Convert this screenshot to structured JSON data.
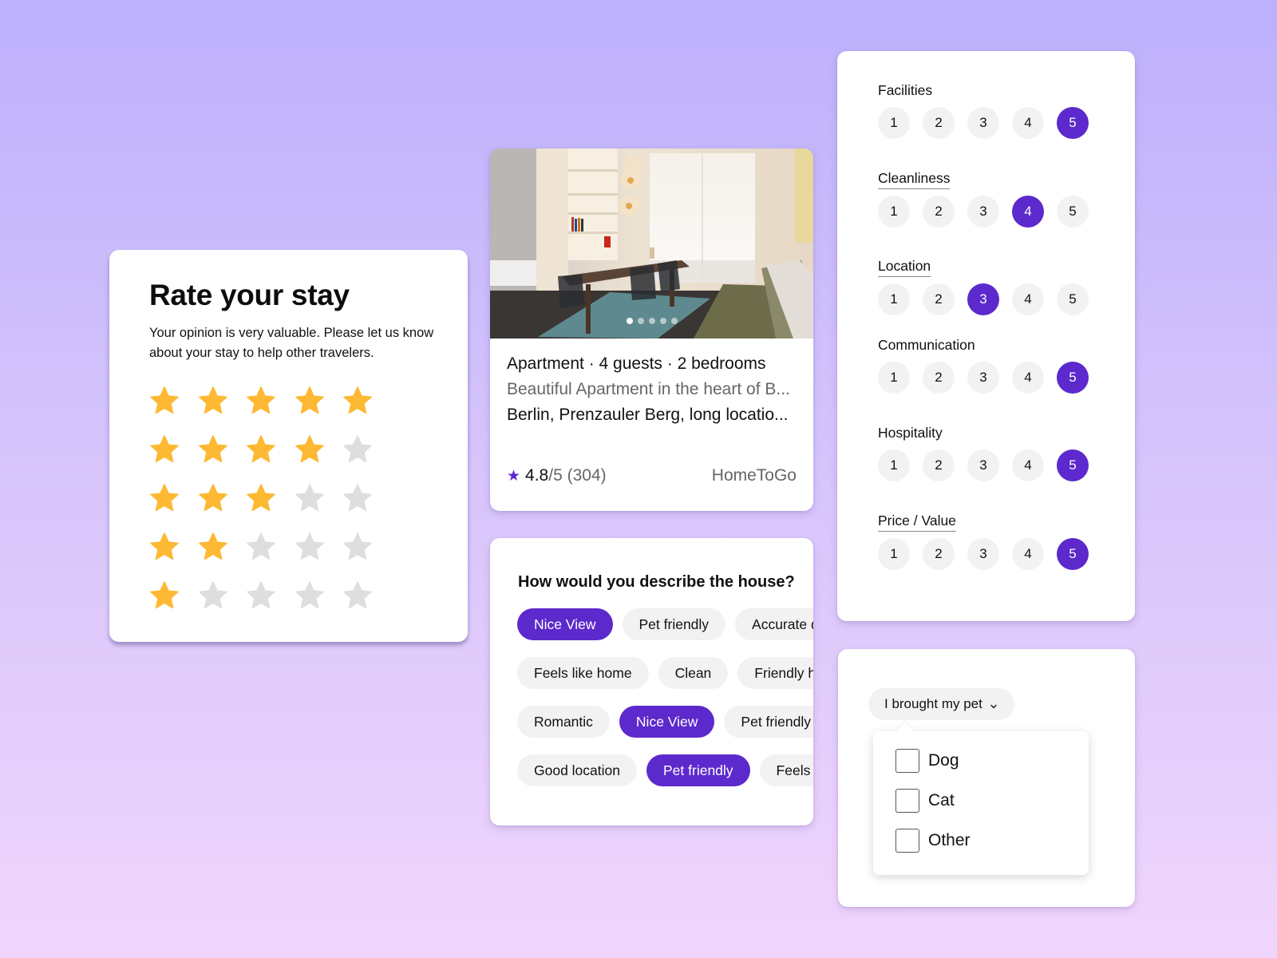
{
  "colors": {
    "accent": "#5c29cc",
    "star_filled": "#fdb933",
    "star_empty": "#dedede",
    "chip_bg": "#f2f2f2"
  },
  "rate_card": {
    "title": "Rate your stay",
    "subtitle": "Your opinion is very valuable. Please let us know about your stay to help other travelers.",
    "star_rows": [
      {
        "filled": 5,
        "total": 5
      },
      {
        "filled": 4,
        "total": 5
      },
      {
        "filled": 3,
        "total": 5
      },
      {
        "filled": 2,
        "total": 5
      },
      {
        "filled": 1,
        "total": 5
      }
    ]
  },
  "listing": {
    "photo_icon": "apartment-photo",
    "photo_count": 5,
    "photo_active_index": 0,
    "type_line": "Apartment · 4 guests · 2 bedrooms",
    "description": "Beautiful Apartment in the heart of B...",
    "location": "Berlin, Prenzauler Berg, long locatio...",
    "rating_icon": "star-icon",
    "rating_score": "4.8",
    "rating_rest": "/5 (304)",
    "provider": "HomeToGo"
  },
  "describe": {
    "question": "How would you describe the house?",
    "rows": [
      [
        {
          "label": "Nice View",
          "selected": true
        },
        {
          "label": "Pet friendly",
          "selected": false
        },
        {
          "label": "Accurate description",
          "selected": false
        }
      ],
      [
        {
          "label": "Feels like home",
          "selected": false
        },
        {
          "label": "Clean",
          "selected": false
        },
        {
          "label": "Friendly host",
          "selected": false
        }
      ],
      [
        {
          "label": "Romantic",
          "selected": false
        },
        {
          "label": "Nice View",
          "selected": true
        },
        {
          "label": "Pet friendly",
          "selected": false
        }
      ],
      [
        {
          "label": "Good location",
          "selected": false
        },
        {
          "label": "Pet friendly",
          "selected": true
        },
        {
          "label": "Feels like home",
          "selected": false
        }
      ]
    ]
  },
  "categories": {
    "scale": [
      "1",
      "2",
      "3",
      "4",
      "5"
    ],
    "items": [
      {
        "label": "Facilities",
        "value": 5,
        "underlined": false
      },
      {
        "label": "Cleanliness",
        "value": 4,
        "underlined": true
      },
      {
        "label": "Location",
        "value": 3,
        "underlined": true
      },
      {
        "label": "Communication",
        "value": 5,
        "underlined": false
      },
      {
        "label": "Hospitality",
        "value": 5,
        "underlined": false
      },
      {
        "label": "Price / Value",
        "value": 5,
        "underlined": true
      }
    ]
  },
  "pet": {
    "dropdown_label": "I brought my pet",
    "dropdown_icon": "chevron-down-icon",
    "options": [
      {
        "label": "Dog",
        "checked": false
      },
      {
        "label": "Cat",
        "checked": false
      },
      {
        "label": "Other",
        "checked": false
      }
    ]
  }
}
